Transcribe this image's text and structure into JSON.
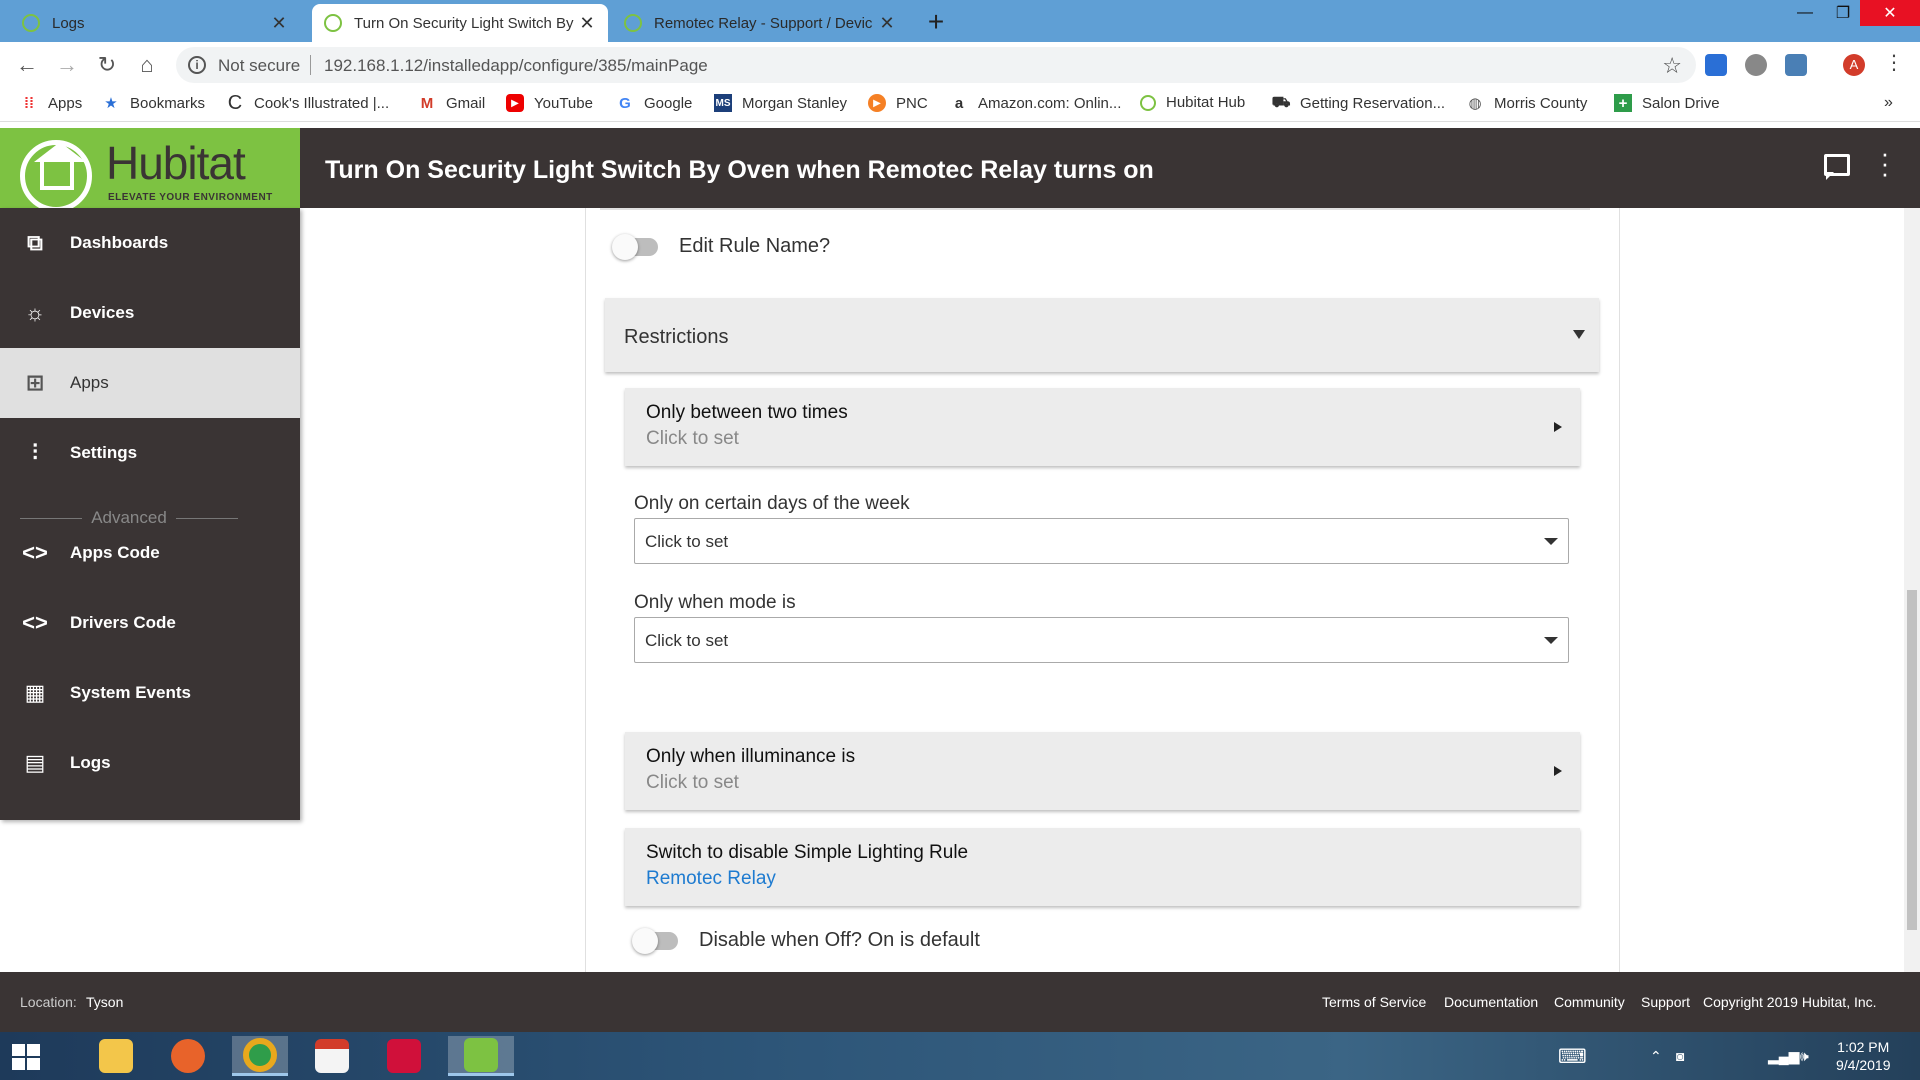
{
  "browser": {
    "tabs": [
      {
        "title": "Logs",
        "active": false
      },
      {
        "title": "Turn On Security Light Switch By",
        "active": true
      },
      {
        "title": "Remotec Relay - Support / Devic",
        "active": false
      }
    ],
    "security_label": "Not secure",
    "url": "192.168.1.12/installedapp/configure/385/mainPage",
    "profile_initial": "A"
  },
  "bookmarks": [
    {
      "label": "Apps",
      "icon": "apps-grid-icon"
    },
    {
      "label": "Bookmarks",
      "icon": "star-icon"
    },
    {
      "label": "Cook's Illustrated |...",
      "icon": "c-icon"
    },
    {
      "label": "Gmail",
      "icon": "gmail-icon"
    },
    {
      "label": "YouTube",
      "icon": "youtube-icon"
    },
    {
      "label": "Google",
      "icon": "google-icon"
    },
    {
      "label": "Morgan Stanley",
      "icon": "ms-icon"
    },
    {
      "label": "PNC",
      "icon": "pnc-icon"
    },
    {
      "label": "Amazon.com: Onlin...",
      "icon": "amazon-icon"
    },
    {
      "label": "Hubitat Hub",
      "icon": "hubitat-icon"
    },
    {
      "label": "Getting Reservation...",
      "icon": "car-icon"
    },
    {
      "label": "Morris  County",
      "icon": "globe-icon"
    },
    {
      "label": "Salon Drive",
      "icon": "plus-icon"
    }
  ],
  "header": {
    "logo_text": "Hubitat",
    "logo_tagline": "ELEVATE YOUR ENVIRONMENT",
    "title": "Turn On Security Light Switch By Oven when Remotec Relay turns on"
  },
  "sidebar": {
    "items": [
      {
        "label": "Dashboards",
        "icon": "dashboards-icon"
      },
      {
        "label": "Devices",
        "icon": "bulb-icon"
      },
      {
        "label": "Apps",
        "icon": "apps-icon"
      },
      {
        "label": "Settings",
        "icon": "sliders-icon"
      },
      {
        "label": "Apps Code",
        "icon": "code-icon"
      },
      {
        "label": "Drivers Code",
        "icon": "code-icon"
      },
      {
        "label": "System Events",
        "icon": "calendar-icon"
      },
      {
        "label": "Logs",
        "icon": "document-icon"
      }
    ],
    "advanced_label": "Advanced",
    "active_item": "Apps"
  },
  "main": {
    "edit_rule_name_label": "Edit Rule Name?",
    "restrictions_title": "Restrictions",
    "between_times": {
      "title": "Only between two times",
      "value": "Click to set"
    },
    "days_label": "Only on certain days of the week",
    "days_value": "Click to set",
    "mode_label": "Only when mode is",
    "mode_value": "Click to set",
    "illuminance": {
      "title": "Only when illuminance is",
      "value": "Click to set"
    },
    "disable_switch": {
      "title": "Switch to disable Simple Lighting Rule",
      "value": "Remotec Relay"
    },
    "disable_when_off_label": "Disable when Off? On is default"
  },
  "footer": {
    "location_label": "Location:",
    "location_value": "Tyson",
    "links": [
      "Terms of Service",
      "Documentation",
      "Community",
      "Support"
    ],
    "copyright": "Copyright 2019 Hubitat, Inc."
  },
  "taskbar": {
    "time": "1:02 PM",
    "date": "9/4/2019"
  },
  "colors": {
    "hubitat_green": "#7dc242",
    "dark_bg": "#3a3434",
    "link_blue": "#1e7bd0",
    "tab_bar_blue": "#5f9fd5"
  }
}
